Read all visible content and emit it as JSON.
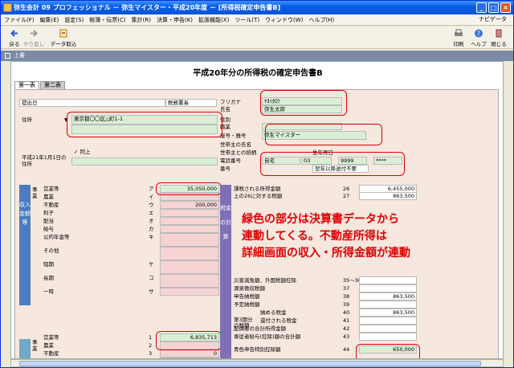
{
  "window": {
    "title": "弥生会計 09 プロフェッショナル － 弥生マイスター・平成20年度 － [所得税確定申告書B]"
  },
  "menu": [
    "ファイル(F)",
    "編集(E)",
    "設定(S)",
    "帳簿・伝票(C)",
    "集計(R)",
    "決算・申告(K)",
    "拡張機能(X)",
    "ツール(T)",
    "ウィンドウ(W)",
    "ヘルプ(H)"
  ],
  "navi": "ナビゲータ",
  "toolbar": {
    "back": "戻る",
    "redo": "やり直し",
    "import": "データ取込",
    "print": "印刷",
    "help": "ヘルプ",
    "close": "閉じる"
  },
  "subbar": "上書",
  "doc_title": "平成20年分の所得税の確定申告書B",
  "tabs": [
    "第一表",
    "第二表"
  ],
  "form": {
    "submit_to": "提出日",
    "tax_office": "税務署長",
    "furigana_label": "フリガナ",
    "furigana_value": "ﾔﾖｲﾀﾛｳ",
    "name_label": "氏名",
    "name_value": "弥生太郎",
    "address_label": "住所",
    "address_value": "東京都〇〇区△町1-1",
    "sex_label": "性別",
    "occupation_label": "職業",
    "trade_label": "屋号・雅号",
    "trade_value": "弥生マイスター",
    "head_label": "世帯主の氏名",
    "head_rel_label": "世帯主との続柄",
    "birth_label": "生年月日",
    "phone_label": "電話番号",
    "phone_type": "自宅",
    "phone1": "03",
    "phone2": "9999",
    "phone3": "****",
    "number_label": "番号",
    "number_value": "翌年以降送付不要",
    "prev_addr_label": "平成21年1月1日の住所",
    "same": "同上"
  },
  "income": [
    {
      "label": "営業等",
      "code": "ア",
      "value": "35,050,000"
    },
    {
      "label": "農業",
      "code": "イ",
      "value": ""
    },
    {
      "label": "不動産",
      "code": "ウ",
      "value": "200,000"
    },
    {
      "label": "利子",
      "code": "エ",
      "value": ""
    },
    {
      "label": "配当",
      "code": "オ",
      "value": ""
    },
    {
      "label": "給与",
      "code": "カ",
      "value": ""
    },
    {
      "label": "公的年金等",
      "code": "キ",
      "value": ""
    },
    {
      "label": "その他",
      "code": "",
      "value": ""
    },
    {
      "label": "短期",
      "code": "ケ",
      "value": ""
    },
    {
      "label": "長期",
      "code": "コ",
      "value": ""
    },
    {
      "label": "一時",
      "code": "サ",
      "value": ""
    }
  ],
  "section_labels": {
    "income_v": "収入金額等",
    "sales_v": "事業",
    "misc_v": "雑",
    "transfer_v": "総合譲渡",
    "deduct_v": "所得金額",
    "tax_v": "税金の計算"
  },
  "shotoku": [
    {
      "label": "営業等",
      "code": "1",
      "value": "6,835,713"
    },
    {
      "label": "農業",
      "code": "2",
      "value": ""
    },
    {
      "label": "不動産",
      "code": "3",
      "value": "0"
    },
    {
      "label": "利子",
      "code": "4",
      "value": ""
    },
    {
      "label": "配当",
      "code": "5",
      "value": ""
    }
  ],
  "tax_rows": [
    {
      "label": "課税される所得金額",
      "code": "26",
      "value": "6,455,000"
    },
    {
      "label": "上の26に対する税額",
      "code": "27",
      "value": "863,500"
    },
    {
      "label": "災害減免額、外国税額控除",
      "code": "35～36",
      "value": ""
    },
    {
      "label": "源泉徴収税額",
      "code": "37",
      "value": ""
    },
    {
      "label": "申告納税額",
      "code": "38",
      "value": "863,500"
    },
    {
      "label": "予定納税額",
      "code": "39",
      "value": ""
    },
    {
      "label": "納める税金",
      "code": "40",
      "value": "863,500"
    },
    {
      "label": "還付される税金",
      "code": "41",
      "value": ""
    },
    {
      "label": "配偶者の合計所得金額",
      "code": "42",
      "value": ""
    },
    {
      "label": "専従者給与(控除)額の合計額",
      "code": "43",
      "value": ""
    },
    {
      "label": "青色申告特別控除額",
      "code": "44",
      "value": "650,000"
    }
  ],
  "tax_extra": {
    "third_period": "第3期分の税額"
  },
  "annotation": [
    "緑色の部分は決算書データから",
    "連動してくる。不動産所得は",
    "詳細画面の収入・所得金額が連動"
  ]
}
